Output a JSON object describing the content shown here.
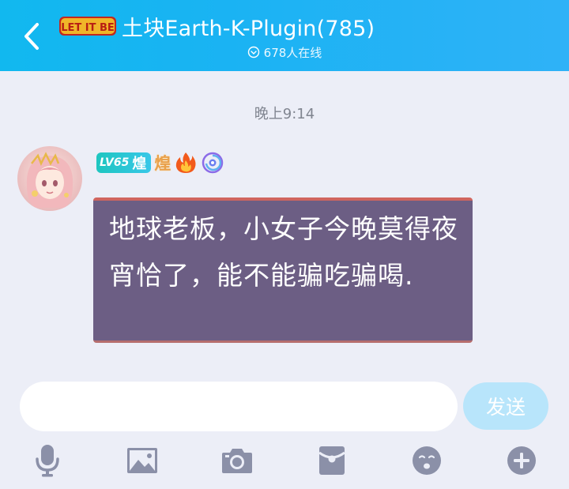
{
  "header": {
    "logo_text": "LET IT BE",
    "title": "土块Earth-K-Plugin(785)",
    "online_count": "678人在线"
  },
  "chat": {
    "timestamp": "晚上9:14",
    "message": {
      "level": "LV65",
      "level_title": "煌",
      "honor_title": "煌",
      "text": "地球老板，小女子今晚莫得夜宵恰了，能不能骗吃骗喝."
    }
  },
  "input": {
    "value": "",
    "send_label": "发送"
  },
  "toolbar": {
    "items": [
      "microphone-icon",
      "image-icon",
      "camera-icon",
      "red-packet-icon",
      "emoji-icon",
      "plus-icon"
    ]
  },
  "colors": {
    "header": "#1ab3f3",
    "background": "#eceef7",
    "bubble": "#6c5e84",
    "send_button": "#b8e5fb",
    "toolbar_icons": "#8b90a8"
  }
}
